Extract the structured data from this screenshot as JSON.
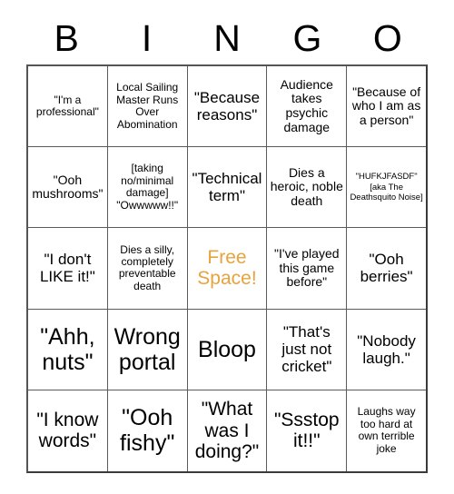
{
  "card": {
    "title": "BINGO",
    "header_letters": [
      "B",
      "I",
      "N",
      "G",
      "O"
    ],
    "free_space_color": "#e8a33d",
    "grid_line_color": "#5a5a5a",
    "rows": [
      [
        {
          "text": "\"I'm a professional\"",
          "size": "sm"
        },
        {
          "text": "Local Sailing Master Runs Over Abomination",
          "size": "sm"
        },
        {
          "text": "\"Because reasons\"",
          "size": "lg"
        },
        {
          "text": "Audience takes psychic damage",
          "size": "md"
        },
        {
          "text": "\"Because of who I am as a person\"",
          "size": "md"
        }
      ],
      [
        {
          "text": "\"Ooh mushrooms\"",
          "size": "md"
        },
        {
          "text": "[taking no/minimal damage] \"Owwwww!!\"",
          "size": "sm"
        },
        {
          "text": "\"Technical term\"",
          "size": "lg"
        },
        {
          "text": "Dies a heroic, noble death",
          "size": "md"
        },
        {
          "text": "\"HUFKJFASDF\" [aka The Deathsquito Noise]",
          "size": "xs"
        }
      ],
      [
        {
          "text": "\"I don't LIKE it!\"",
          "size": "lg"
        },
        {
          "text": "Dies a silly, completely preventable death",
          "size": "sm"
        },
        {
          "text": "Free Space!",
          "size": "free",
          "is_free_space": true
        },
        {
          "text": "\"I've played this game before\"",
          "size": "md"
        },
        {
          "text": "\"Ooh berries\"",
          "size": "lg"
        }
      ],
      [
        {
          "text": "\"Ahh, nuts\"",
          "size": "xxl"
        },
        {
          "text": "Wrong portal",
          "size": "xxl"
        },
        {
          "text": "Bloop",
          "size": "xxl"
        },
        {
          "text": "\"That's just not cricket\"",
          "size": "lg"
        },
        {
          "text": "\"Nobody laugh.\"",
          "size": "lg"
        }
      ],
      [
        {
          "text": "\"I know words\"",
          "size": "xl"
        },
        {
          "text": "\"Ooh fishy\"",
          "size": "xxl"
        },
        {
          "text": "\"What was I doing?\"",
          "size": "xl"
        },
        {
          "text": "\"Ssstop it!!\"",
          "size": "xl"
        },
        {
          "text": "Laughs way too hard at own terrible joke",
          "size": "sm"
        }
      ]
    ]
  }
}
